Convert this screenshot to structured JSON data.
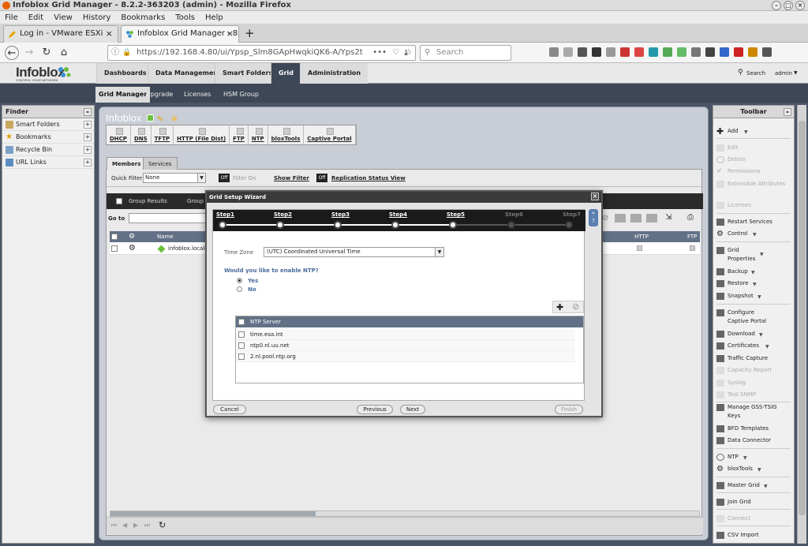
{
  "window": {
    "title": "Infoblox Grid Manager - 8.2.2-363203 (admin) - Mozilla Firefox"
  },
  "menu": [
    "File",
    "Edit",
    "View",
    "History",
    "Bookmarks",
    "Tools",
    "Help"
  ],
  "tabs": [
    {
      "label": "Log in - VMware ESXi",
      "active": false
    },
    {
      "label": "Infoblox Grid Manager - 8",
      "active": true
    }
  ],
  "nav": {
    "url": "https://192.168.4.80/ui/Ypsp_Slm8GApHwqkiQK6-A/Yps2t",
    "search_placeholder": "Search"
  },
  "app": {
    "logo": "Infoblox",
    "logo_tagline": "CONTROL YOUR NETWORK",
    "main_tabs": [
      "Dashboards",
      "Data Management",
      "Smart Folders",
      "Grid",
      "Administration"
    ],
    "active_tab": "Grid",
    "search_label": "Search",
    "user": "admin",
    "sub_tabs": [
      "Grid Manager",
      "Upgrade",
      "Licenses",
      "HSM Group"
    ]
  },
  "finder": {
    "title": "Finder",
    "items": [
      "Smart Folders",
      "Bookmarks",
      "Recycle Bin",
      "URL Links"
    ]
  },
  "toolbar": {
    "title": "Toolbar",
    "items": [
      {
        "label": "Add",
        "disabled": false
      },
      {
        "label": "Edit",
        "disabled": true
      },
      {
        "label": "Delete",
        "disabled": true
      },
      {
        "label": "Permissions",
        "disabled": true
      },
      {
        "label": "Extensible Attributes",
        "disabled": true
      },
      {
        "label": "Licenses",
        "disabled": true
      },
      {
        "label": "Restart Services",
        "disabled": false
      },
      {
        "label": "Control",
        "disabled": false
      },
      {
        "label": "Grid Properties",
        "disabled": false
      },
      {
        "label": "Backup",
        "disabled": false
      },
      {
        "label": "Restore",
        "disabled": false
      },
      {
        "label": "Snapshot",
        "disabled": false
      },
      {
        "label": "Configure Captive Portal",
        "disabled": false
      },
      {
        "label": "Download",
        "disabled": false
      },
      {
        "label": "Certificates",
        "disabled": false
      },
      {
        "label": "Traffic Capture",
        "disabled": false
      },
      {
        "label": "Capacity Report",
        "disabled": true
      },
      {
        "label": "Syslog",
        "disabled": true
      },
      {
        "label": "Test SNMP",
        "disabled": true
      },
      {
        "label": "Manage GSS-TSIG Keys",
        "disabled": false
      },
      {
        "label": "BFD Templates",
        "disabled": false
      },
      {
        "label": "Data Connector",
        "disabled": false
      },
      {
        "label": "NTP",
        "disabled": false
      },
      {
        "label": "bloxTools",
        "disabled": false
      },
      {
        "label": "Master Grid",
        "disabled": false
      },
      {
        "label": "Join Grid",
        "disabled": false
      },
      {
        "label": "Connect",
        "disabled": true
      },
      {
        "label": "CSV Import",
        "disabled": false
      }
    ]
  },
  "content": {
    "title": "Infoblox",
    "services": [
      "DHCP",
      "DNS",
      "TFTP",
      "HTTP (File Dist)",
      "FTP",
      "NTP",
      "bloxTools",
      "Captive Portal"
    ],
    "panel_tabs": [
      "Members",
      "Services"
    ],
    "quick_filter_label": "Quick Filter",
    "quick_filter_value": "None",
    "filter_off": "Off",
    "filter_on": "Filter On",
    "show_filter": "Show Filter",
    "replication_off": "Off",
    "replication_view": "Replication Status View",
    "group_results": "Group Results",
    "group_by": "Group",
    "goto": "Go to",
    "columns": {
      "name": "Name",
      "http": "HTTP",
      "ftp": "FTP"
    },
    "row_name": "infoblox.localdo"
  },
  "wizard": {
    "title": "Grid Setup Wizard",
    "steps": [
      "Step1",
      "Step2",
      "Step3",
      "Step4",
      "Step5",
      "Step6",
      "Step7"
    ],
    "current_step": 5,
    "timezone_label": "Time Zone",
    "timezone_value": "(UTC) Coordinated Universal Time",
    "question": "Would you like to enable NTP?",
    "options": [
      "Yes",
      "No"
    ],
    "selected": "Yes",
    "ntp_header": "NTP Server",
    "ntp_servers": [
      "time.esa.int",
      "ntp0.nl.uu.net",
      "2.nl.pool.ntp.org"
    ],
    "buttons": {
      "cancel": "Cancel",
      "previous": "Previous",
      "next": "Next",
      "finish": "Finish"
    }
  }
}
